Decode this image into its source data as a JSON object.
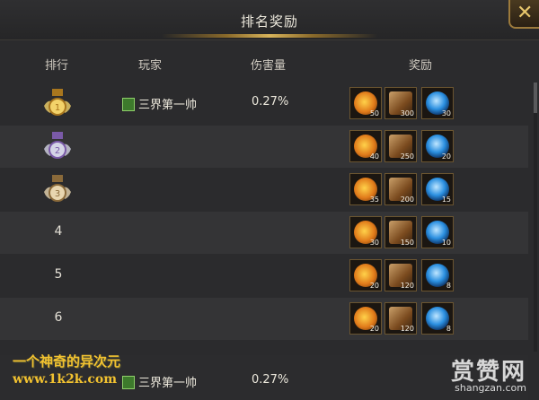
{
  "title": "排名奖励",
  "headers": {
    "rank": "排行",
    "player": "玩家",
    "damage": "伤害量",
    "reward": "奖励"
  },
  "rows": [
    {
      "rank": "1",
      "medal": "gold-medal",
      "player": "三界第一帅",
      "damage": "0.27%",
      "rewards": [
        "50",
        "300",
        "30"
      ]
    },
    {
      "rank": "2",
      "medal": "silver-medal",
      "player": "",
      "damage": "",
      "rewards": [
        "40",
        "250",
        "20"
      ]
    },
    {
      "rank": "3",
      "medal": "bronze-medal",
      "player": "",
      "damage": "",
      "rewards": [
        "35",
        "200",
        "15"
      ]
    },
    {
      "rank": "4",
      "medal": "",
      "player": "",
      "damage": "",
      "rewards": [
        "30",
        "150",
        "10"
      ]
    },
    {
      "rank": "5",
      "medal": "",
      "player": "",
      "damage": "",
      "rewards": [
        "20",
        "120",
        "8"
      ]
    },
    {
      "rank": "6",
      "medal": "",
      "player": "",
      "damage": "",
      "rewards": [
        "20",
        "120",
        "8"
      ]
    }
  ],
  "my_rank": {
    "player": "三界第一帅",
    "damage": "0.27%"
  },
  "watermark": {
    "text": "一个神奇的异次元",
    "url": "www.1k2k.com",
    "logo": "赏赞网",
    "logo_url": "shangzan.com"
  },
  "colors": {
    "gold": "#e8c76c",
    "orange_item": "#e07a1a",
    "scroll_item": "#8a5a2a",
    "blue_orb": "#2a8fe0"
  }
}
